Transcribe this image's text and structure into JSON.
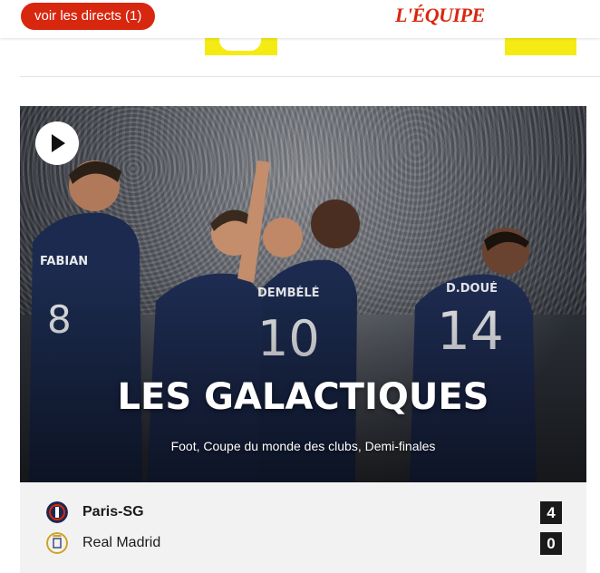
{
  "header": {
    "live_button_label": "voir les directs (1)",
    "logo_text": "L'ÉQUIPE"
  },
  "colors": {
    "brand_red": "#d8270f",
    "ad_yellow": "#f5eb14",
    "psg_navy": "#1b2a4e",
    "score_bg": "#1a1a1a"
  },
  "article": {
    "headline": "LES GALACTIQUES",
    "subline": "Foot, Coupe du monde des clubs, Demi-finales",
    "media_icon": "play-icon"
  },
  "match": {
    "teams": [
      {
        "name": "Paris-SG",
        "score": "4",
        "winner": true,
        "icon": "psg-crest-icon"
      },
      {
        "name": "Real Madrid",
        "score": "0",
        "winner": false,
        "icon": "real-madrid-crest-icon"
      }
    ]
  }
}
